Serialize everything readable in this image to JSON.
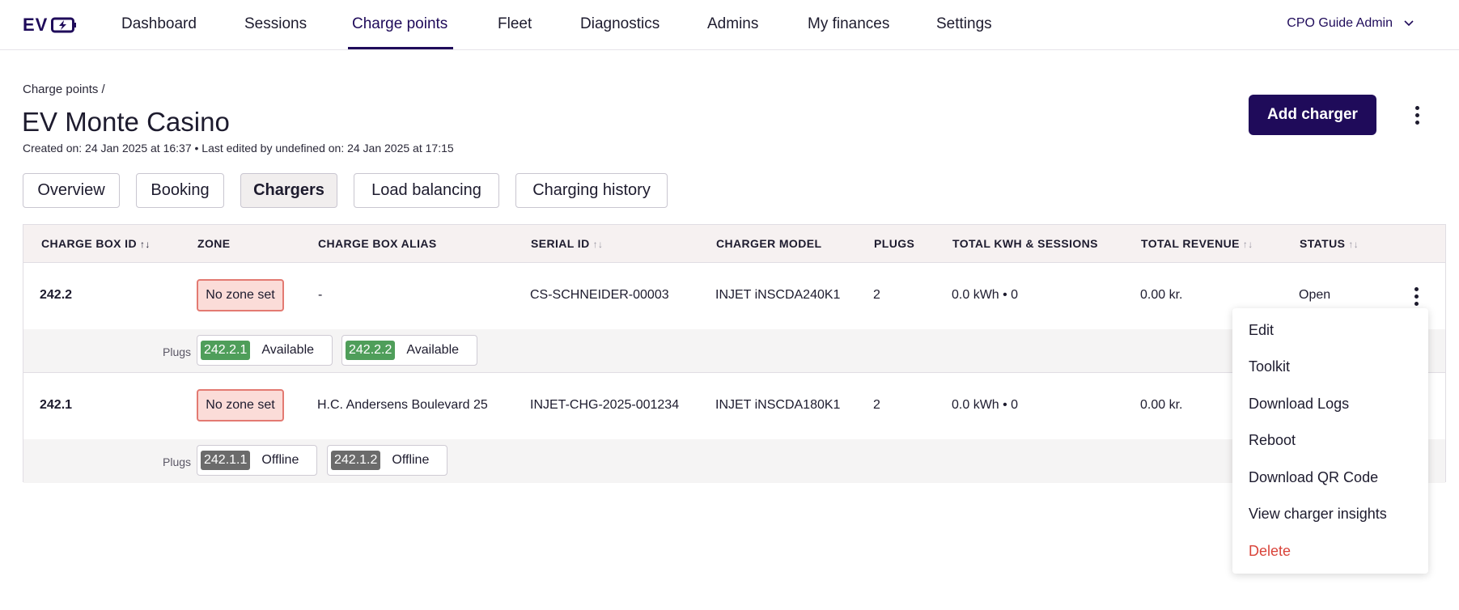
{
  "nav": {
    "logo": "EV",
    "items": [
      "Dashboard",
      "Sessions",
      "Charge points",
      "Fleet",
      "Diagnostics",
      "Admins",
      "My finances",
      "Settings"
    ],
    "active": "Charge points",
    "user": "CPO Guide Admin"
  },
  "header": {
    "breadcrumb": "Charge points /",
    "title": "EV Monte Casino",
    "meta": "Created on: 24 Jan 2025 at 16:37 • Last edited by undefined on: 24 Jan 2025 at 17:15",
    "add_label": "Add charger"
  },
  "tabs": [
    "Overview",
    "Booking",
    "Chargers",
    "Load balancing",
    "Charging history"
  ],
  "active_tab": "Chargers",
  "table": {
    "columns": [
      "CHARGE BOX ID",
      "ZONE",
      "CHARGE BOX ALIAS",
      "SERIAL ID",
      "CHARGER MODEL",
      "PLUGS",
      "TOTAL KWH & SESSIONS",
      "TOTAL REVENUE",
      "STATUS"
    ],
    "plugs_label": "Plugs",
    "rows": [
      {
        "id": "242.2",
        "zone": "No zone set",
        "alias": "-",
        "serial": "CS-SCHNEIDER-00003",
        "model": "INJET iNSCDA240K1",
        "plugs": "2",
        "kwh": "0.0 kWh • 0",
        "revenue": "0.00 kr.",
        "status": "Open",
        "plug_items": [
          {
            "id": "242.2.1",
            "status": "Available",
            "color": "#4f9e5a"
          },
          {
            "id": "242.2.2",
            "status": "Available",
            "color": "#4f9e5a"
          }
        ]
      },
      {
        "id": "242.1",
        "zone": "No zone set",
        "alias": "H.C. Andersens Boulevard 25",
        "serial": "INJET-CHG-2025-001234",
        "model": "INJET iNSCDA180K1",
        "plugs": "2",
        "kwh": "0.0 kWh • 0",
        "revenue": "0.00 kr.",
        "status": "",
        "plug_items": [
          {
            "id": "242.1.1",
            "status": "Offline",
            "color": "#6b6b6b"
          },
          {
            "id": "242.1.2",
            "status": "Offline",
            "color": "#6b6b6b"
          }
        ]
      }
    ]
  },
  "menu": {
    "items": [
      "Edit",
      "Toolkit",
      "Download Logs",
      "Reboot",
      "Download QR Code",
      "View charger insights",
      "Delete"
    ],
    "danger_color": "#d9443a"
  },
  "colors": {
    "brand": "#1f0b5a",
    "zone_border": "#e37a72",
    "zone_bg": "#fbdcd8"
  }
}
